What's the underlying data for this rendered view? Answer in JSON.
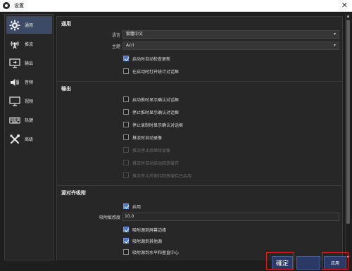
{
  "window": {
    "title": "设置",
    "close_glyph": "✕"
  },
  "sidebar": {
    "items": [
      {
        "label": "通用",
        "icon": "gear-icon",
        "active": true
      },
      {
        "label": "推流",
        "icon": "broadcast-icon",
        "active": false
      },
      {
        "label": "输出",
        "icon": "output-icon",
        "active": false
      },
      {
        "label": "音频",
        "icon": "speaker-icon",
        "active": false
      },
      {
        "label": "视频",
        "icon": "monitor-icon",
        "active": false
      },
      {
        "label": "热键",
        "icon": "keyboard-icon",
        "active": false
      },
      {
        "label": "高级",
        "icon": "tools-icon",
        "active": false
      }
    ]
  },
  "general": {
    "title": "通用",
    "language_label": "语言",
    "language_value": "繁體中文",
    "theme_label": "主题",
    "theme_value": "Acri",
    "check_updates": {
      "label": "启动时自动检查更新",
      "checked": true
    },
    "open_stats": {
      "label": "在启动时打开统计对话框",
      "checked": false
    }
  },
  "output": {
    "title": "输出",
    "options": [
      {
        "label": "启动推时显示确认对话框",
        "checked": false,
        "disabled": false
      },
      {
        "label": "停止推时显示确认对话框",
        "checked": false,
        "disabled": false
      },
      {
        "label": "停止录制时显示确认对话框",
        "checked": false,
        "disabled": false
      },
      {
        "label": "推流时自动录像",
        "checked": false,
        "disabled": false
      },
      {
        "label": "推流停止后继续录像",
        "checked": false,
        "disabled": true
      },
      {
        "label": "推流时自动启动回放缓存",
        "checked": false,
        "disabled": true
      },
      {
        "label": "推流停止后保持回放缓存已启用",
        "checked": false,
        "disabled": true
      }
    ]
  },
  "snapping": {
    "title": "源对齐吸附",
    "enable": {
      "label": "启用",
      "checked": true
    },
    "sensitivity_label": "吸附敏感度",
    "sensitivity_value": "10.0",
    "options": [
      {
        "label": "吸附源到屏幕边缘",
        "checked": true
      },
      {
        "label": "吸附源到其他源",
        "checked": true
      },
      {
        "label": "吸附源到水平和垂直中心",
        "checked": false
      }
    ]
  },
  "buttons": {
    "ok": "確定",
    "cancel": "",
    "apply": "应用"
  },
  "colors": {
    "accent": "#4a78c8",
    "highlight": "#e02020",
    "background": "#1e1e1e",
    "panel": "#272727"
  }
}
